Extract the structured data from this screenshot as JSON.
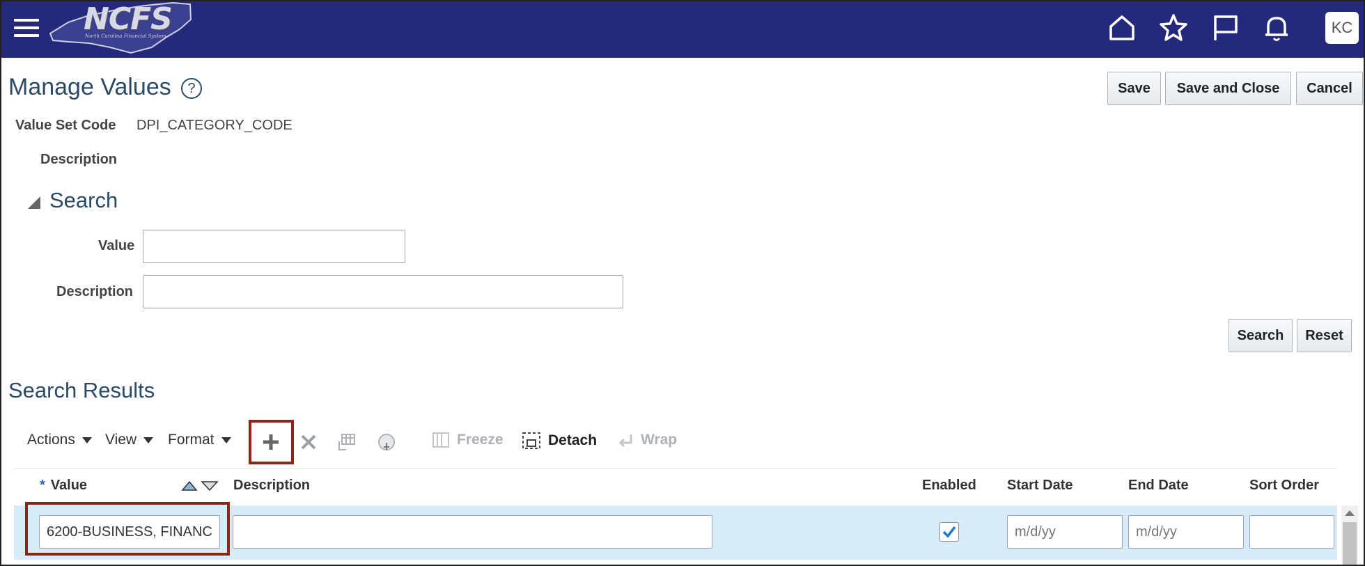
{
  "header": {
    "logo_text": "NCFS",
    "logo_subtitle": "North Carolina Financial System",
    "avatar_initials": "KC",
    "icons": [
      "menu-icon",
      "home-icon",
      "star-icon",
      "flag-icon",
      "bell-icon"
    ]
  },
  "page": {
    "title": "Manage Values",
    "buttons": {
      "save": "Save",
      "save_close": "Save and Close",
      "cancel": "Cancel"
    }
  },
  "details": {
    "value_set_code_label": "Value Set Code",
    "value_set_code": "DPI_CATEGORY_CODE",
    "description_label": "Description"
  },
  "search": {
    "title": "Search",
    "value_label": "Value",
    "value_input": "",
    "description_label": "Description",
    "description_input": "",
    "search_button": "Search",
    "reset_button": "Reset"
  },
  "results": {
    "title": "Search Results",
    "toolbar": {
      "actions": "Actions",
      "view": "View",
      "format": "Format",
      "freeze": "Freeze",
      "detach": "Detach",
      "wrap": "Wrap"
    },
    "columns": [
      "Value",
      "Description",
      "Enabled",
      "Start Date",
      "End Date",
      "Sort Order"
    ],
    "required_marker": "*",
    "rows": [
      {
        "value": "6200-BUSINESS, FINANC",
        "description": "",
        "enabled": true,
        "start_date_placeholder": "m/d/yy",
        "end_date_placeholder": "m/d/yy",
        "sort_order": ""
      }
    ]
  },
  "colors": {
    "topbar": "#25297b",
    "title": "#2b4a66",
    "selected_row": "#d7ebf8",
    "highlight": "#8b2618"
  }
}
